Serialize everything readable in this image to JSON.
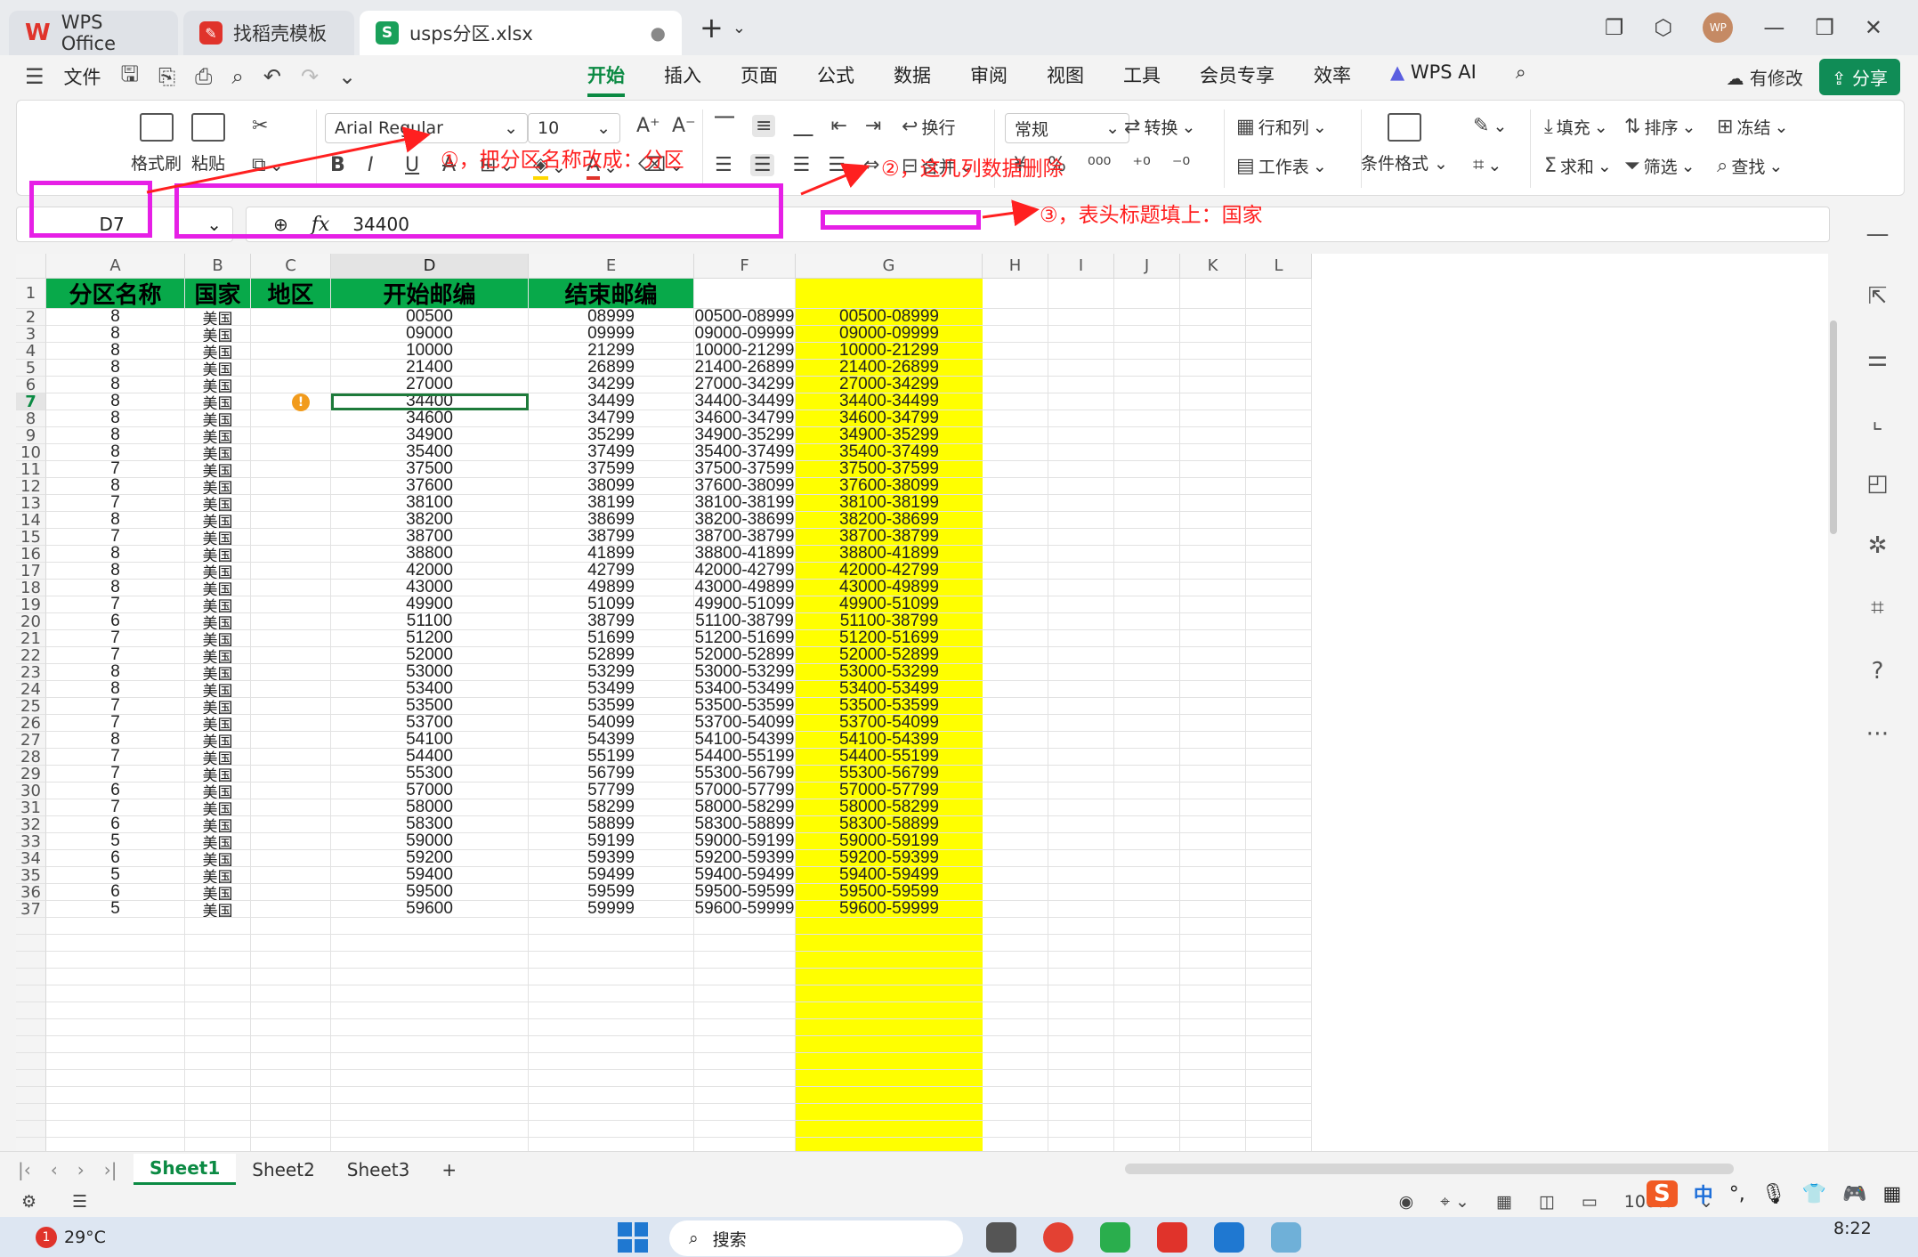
{
  "titlebar": {
    "tabs": [
      {
        "label": "WPS Office"
      },
      {
        "label": "找稻壳模板"
      },
      {
        "label": "usps分区.xlsx"
      }
    ],
    "avatar_text": "WP"
  },
  "menubar": {
    "file_label": "文件",
    "tabs": [
      "开始",
      "插入",
      "页面",
      "公式",
      "数据",
      "审阅",
      "视图",
      "工具",
      "会员专享",
      "效率"
    ],
    "active_tab": "开始",
    "ai_label": "WPS AI",
    "modify_label": "有修改",
    "share_label": "分享"
  },
  "ribbon": {
    "format_painter": "格式刷",
    "paste": "粘贴",
    "font_name": "Arial Regular",
    "font_size": "10",
    "wrap": "换行",
    "merge": "合并",
    "number_format": "常规",
    "convert": "转换",
    "row_col": "行和列",
    "worksheet": "工作表",
    "cond_format": "条件格式",
    "fill": "填充",
    "sort": "排序",
    "freeze": "冻结",
    "sum": "求和",
    "filter": "筛选",
    "find": "查找",
    "currency": "¥",
    "percent": "%"
  },
  "formula": {
    "name_box": "D7",
    "value": "34400"
  },
  "grid": {
    "columns": [
      "A",
      "B",
      "C",
      "D",
      "E",
      "F",
      "G",
      "H",
      "I",
      "J",
      "K",
      "L"
    ],
    "header_row": {
      "A": "分区名称",
      "B": "国家",
      "C": "地区",
      "D": "开始邮编",
      "E": "结束邮编"
    },
    "rows": [
      {
        "r": 2,
        "a": "8",
        "b": "美国",
        "d": "00500",
        "e": "08999",
        "f": "00500-08999",
        "g": "00500-08999"
      },
      {
        "r": 3,
        "a": "8",
        "b": "美国",
        "d": "09000",
        "e": "09999",
        "f": "09000-09999",
        "g": "09000-09999"
      },
      {
        "r": 4,
        "a": "8",
        "b": "美国",
        "d": "10000",
        "e": "21299",
        "f": "10000-21299",
        "g": "10000-21299"
      },
      {
        "r": 5,
        "a": "8",
        "b": "美国",
        "d": "21400",
        "e": "26899",
        "f": "21400-26899",
        "g": "21400-26899"
      },
      {
        "r": 6,
        "a": "8",
        "b": "美国",
        "d": "27000",
        "e": "34299",
        "f": "27000-34299",
        "g": "27000-34299"
      },
      {
        "r": 7,
        "a": "8",
        "b": "美国",
        "d": "34400",
        "e": "34499",
        "f": "34400-34499",
        "g": "34400-34499"
      },
      {
        "r": 8,
        "a": "8",
        "b": "美国",
        "d": "34600",
        "e": "34799",
        "f": "34600-34799",
        "g": "34600-34799"
      },
      {
        "r": 9,
        "a": "8",
        "b": "美国",
        "d": "34900",
        "e": "35299",
        "f": "34900-35299",
        "g": "34900-35299"
      },
      {
        "r": 10,
        "a": "8",
        "b": "美国",
        "d": "35400",
        "e": "37499",
        "f": "35400-37499",
        "g": "35400-37499"
      },
      {
        "r": 11,
        "a": "7",
        "b": "美国",
        "d": "37500",
        "e": "37599",
        "f": "37500-37599",
        "g": "37500-37599"
      },
      {
        "r": 12,
        "a": "8",
        "b": "美国",
        "d": "37600",
        "e": "38099",
        "f": "37600-38099",
        "g": "37600-38099"
      },
      {
        "r": 13,
        "a": "7",
        "b": "美国",
        "d": "38100",
        "e": "38199",
        "f": "38100-38199",
        "g": "38100-38199"
      },
      {
        "r": 14,
        "a": "8",
        "b": "美国",
        "d": "38200",
        "e": "38699",
        "f": "38200-38699",
        "g": "38200-38699"
      },
      {
        "r": 15,
        "a": "7",
        "b": "美国",
        "d": "38700",
        "e": "38799",
        "f": "38700-38799",
        "g": "38700-38799"
      },
      {
        "r": 16,
        "a": "8",
        "b": "美国",
        "d": "38800",
        "e": "41899",
        "f": "38800-41899",
        "g": "38800-41899"
      },
      {
        "r": 17,
        "a": "8",
        "b": "美国",
        "d": "42000",
        "e": "42799",
        "f": "42000-42799",
        "g": "42000-42799"
      },
      {
        "r": 18,
        "a": "8",
        "b": "美国",
        "d": "43000",
        "e": "49899",
        "f": "43000-49899",
        "g": "43000-49899"
      },
      {
        "r": 19,
        "a": "7",
        "b": "美国",
        "d": "49900",
        "e": "51099",
        "f": "49900-51099",
        "g": "49900-51099"
      },
      {
        "r": 20,
        "a": "6",
        "b": "美国",
        "d": "51100",
        "e": "38799",
        "f": "51100-38799",
        "g": "51100-38799"
      },
      {
        "r": 21,
        "a": "7",
        "b": "美国",
        "d": "51200",
        "e": "51699",
        "f": "51200-51699",
        "g": "51200-51699"
      },
      {
        "r": 22,
        "a": "7",
        "b": "美国",
        "d": "52000",
        "e": "52899",
        "f": "52000-52899",
        "g": "52000-52899"
      },
      {
        "r": 23,
        "a": "8",
        "b": "美国",
        "d": "53000",
        "e": "53299",
        "f": "53000-53299",
        "g": "53000-53299"
      },
      {
        "r": 24,
        "a": "8",
        "b": "美国",
        "d": "53400",
        "e": "53499",
        "f": "53400-53499",
        "g": "53400-53499"
      },
      {
        "r": 25,
        "a": "7",
        "b": "美国",
        "d": "53500",
        "e": "53599",
        "f": "53500-53599",
        "g": "53500-53599"
      },
      {
        "r": 26,
        "a": "7",
        "b": "美国",
        "d": "53700",
        "e": "54099",
        "f": "53700-54099",
        "g": "53700-54099"
      },
      {
        "r": 27,
        "a": "8",
        "b": "美国",
        "d": "54100",
        "e": "54399",
        "f": "54100-54399",
        "g": "54100-54399"
      },
      {
        "r": 28,
        "a": "7",
        "b": "美国",
        "d": "54400",
        "e": "55199",
        "f": "54400-55199",
        "g": "54400-55199"
      },
      {
        "r": 29,
        "a": "7",
        "b": "美国",
        "d": "55300",
        "e": "56799",
        "f": "55300-56799",
        "g": "55300-56799"
      },
      {
        "r": 30,
        "a": "6",
        "b": "美国",
        "d": "57000",
        "e": "57799",
        "f": "57000-57799",
        "g": "57000-57799"
      },
      {
        "r": 31,
        "a": "7",
        "b": "美国",
        "d": "58000",
        "e": "58299",
        "f": "58000-58299",
        "g": "58000-58299"
      },
      {
        "r": 32,
        "a": "6",
        "b": "美国",
        "d": "58300",
        "e": "58899",
        "f": "58300-58899",
        "g": "58300-58899"
      },
      {
        "r": 33,
        "a": "5",
        "b": "美国",
        "d": "59000",
        "e": "59199",
        "f": "59000-59199",
        "g": "59000-59199"
      },
      {
        "r": 34,
        "a": "6",
        "b": "美国",
        "d": "59200",
        "e": "59399",
        "f": "59200-59399",
        "g": "59200-59399"
      },
      {
        "r": 35,
        "a": "5",
        "b": "美国",
        "d": "59400",
        "e": "59499",
        "f": "59400-59499",
        "g": "59400-59499"
      },
      {
        "r": 36,
        "a": "6",
        "b": "美国",
        "d": "59500",
        "e": "59599",
        "f": "59500-59599",
        "g": "59500-59599"
      },
      {
        "r": 37,
        "a": "5",
        "b": "美国",
        "d": "59600",
        "e": "59999",
        "f": "59600-59999",
        "g": "59600-59999"
      }
    ],
    "active_cell": "D7"
  },
  "annotations": {
    "note1": "①，把分区名称改成：分区",
    "note2": "②，这几列数据删除",
    "note3": "③，表头标题填上：国家"
  },
  "sheets": [
    "Sheet1",
    "Sheet2",
    "Sheet3"
  ],
  "active_sheet": "Sheet1",
  "status": {
    "zoom": "100%"
  },
  "taskbar": {
    "badge_count": "1",
    "temperature": "29°C",
    "search_placeholder": "搜索",
    "time": "8:22"
  },
  "ime": {
    "lang": "中"
  },
  "colors": {
    "header_green": "#08a94a",
    "highlight_yellow": "#ffff00",
    "annotation_magenta": "#e61fe6",
    "annotation_red": "#ff2020",
    "accent_green": "#0b8a43"
  }
}
